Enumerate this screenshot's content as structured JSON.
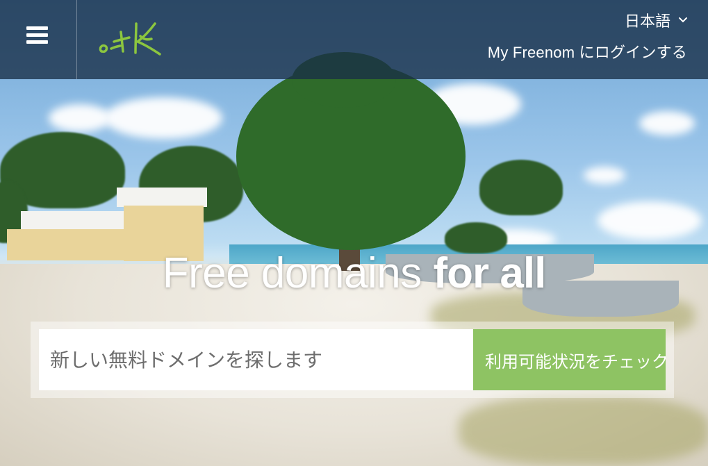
{
  "header": {
    "menu_icon": "hamburger-menu-icon",
    "logo": {
      "text": ".tk",
      "color": "#8cc63f"
    },
    "language": {
      "label": "日本語",
      "icon": "chevron-down-icon"
    },
    "login": {
      "brand": "My Freenom",
      "suffix": " にログインする"
    }
  },
  "hero": {
    "title_light": "Free domains ",
    "title_bold": "for all"
  },
  "search": {
    "placeholder": "新しい無料ドメインを探します",
    "value": "",
    "button_label": "利用可能状況をチェック",
    "button_color": "#8ec363"
  },
  "colors": {
    "header_bg": "rgba(24,46,70,0.78)",
    "accent": "#8cc63f"
  }
}
